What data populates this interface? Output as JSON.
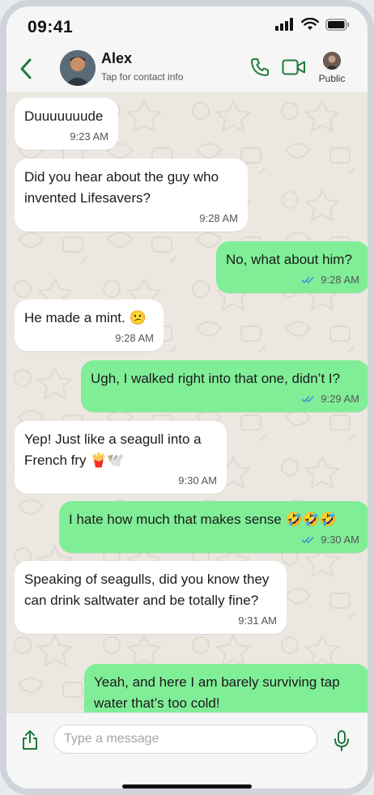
{
  "status_bar": {
    "time": "09:41",
    "icons": [
      "cellular-signal-icon",
      "wifi-icon",
      "battery-icon"
    ]
  },
  "header": {
    "contact_name": "Alex",
    "subtitle": "Tap for contact info",
    "public_label": "Public",
    "icons": [
      "back-chevron-icon",
      "phone-call-icon",
      "video-call-icon"
    ],
    "accent_color": "#1f7a3a"
  },
  "messages": [
    {
      "direction": "incoming",
      "text": "Duuuuuuude",
      "time": "9:23 AM"
    },
    {
      "direction": "incoming",
      "text": "Did you hear about the guy who invented Lifesavers?",
      "time": "9:28 AM"
    },
    {
      "direction": "outgoing",
      "text": "No, what about him?",
      "time": "9:28 AM",
      "status": "read"
    },
    {
      "direction": "incoming",
      "text": "He made a mint.",
      "emoji": "😕",
      "time": "9:28 AM"
    },
    {
      "direction": "outgoing",
      "text": "Ugh, I walked right into that one, didn’t I?",
      "time": "9:29 AM",
      "status": "read"
    },
    {
      "direction": "incoming",
      "text": "Yep! Just like a seagull into a French fry",
      "emoji": "🍟🕊️",
      "time": "9:30 AM"
    },
    {
      "direction": "outgoing",
      "text": "I hate how much that makes sense",
      "emoji": "🤣🤣🤣",
      "time": "9:30 AM",
      "status": "read"
    },
    {
      "direction": "incoming",
      "text": "Speaking of seagulls, did you know they can drink saltwater and be totally fine?",
      "time": "9:31 AM"
    },
    {
      "direction": "outgoing",
      "text": "Yeah, and here I am barely surviving tap water that’s too cold!",
      "time": "",
      "status": ""
    }
  ],
  "composer": {
    "placeholder": "Type a message",
    "icons": [
      "share-icon",
      "microphone-icon"
    ]
  },
  "colors": {
    "incoming_bubble": "#ffffff",
    "outgoing_bubble": "#80ee97",
    "read_check": "#4a90d9",
    "chat_background": "#ece8e1"
  }
}
